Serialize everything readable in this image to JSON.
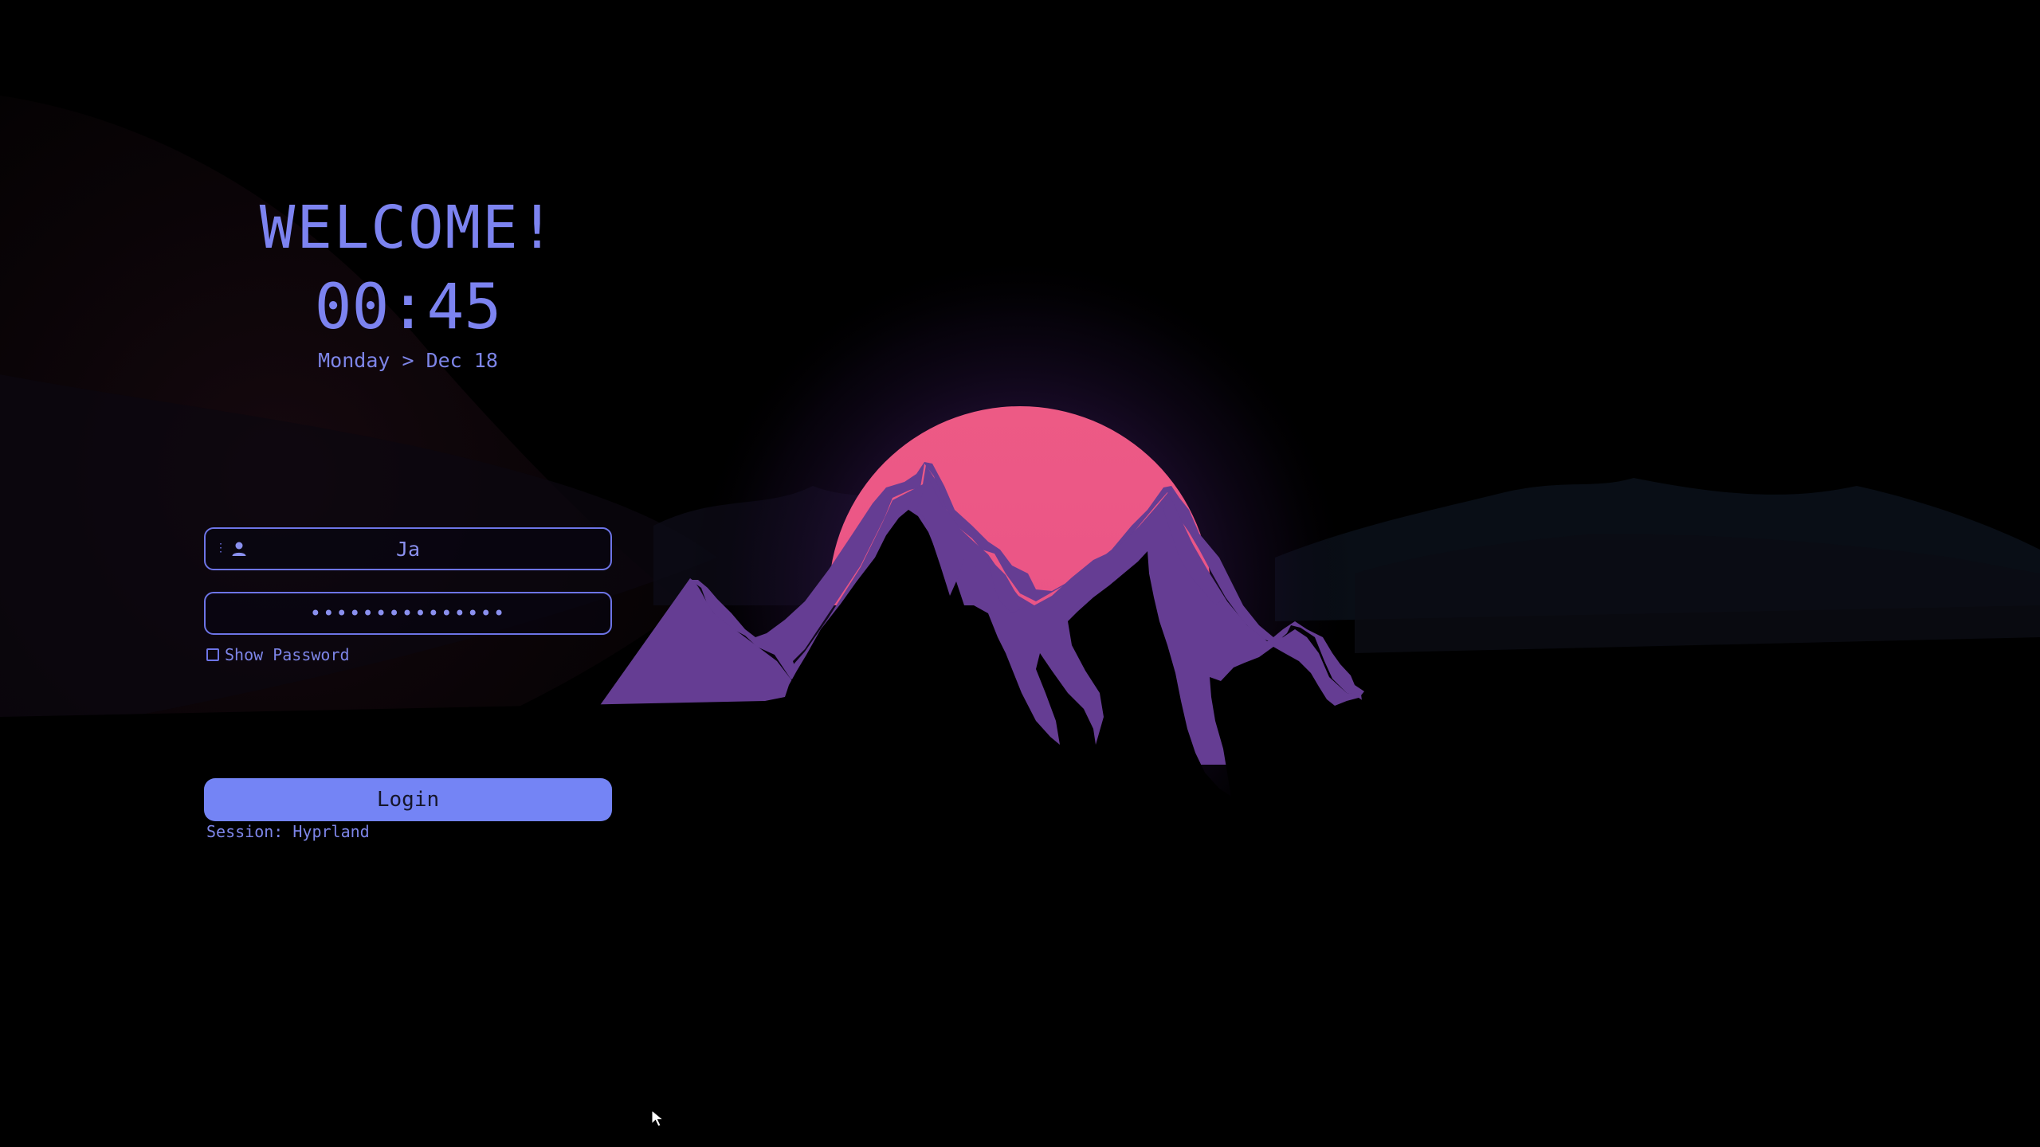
{
  "greeter": {
    "welcome": "WELCOME!",
    "time": "00:45",
    "date": "Monday > Dec 18"
  },
  "username": {
    "value": "Ja",
    "icon": "user-icon"
  },
  "password": {
    "masked_value": "•••••••••••••••"
  },
  "show_password": {
    "label": "Show Password",
    "checked": false
  },
  "login": {
    "label": "Login"
  },
  "session": {
    "label": "Session: Hyprland"
  },
  "colors": {
    "accent": "#7484f5",
    "text": "#7c83f0",
    "sun": "#ea5586",
    "mountain": "#653d93",
    "background": "#000000"
  }
}
